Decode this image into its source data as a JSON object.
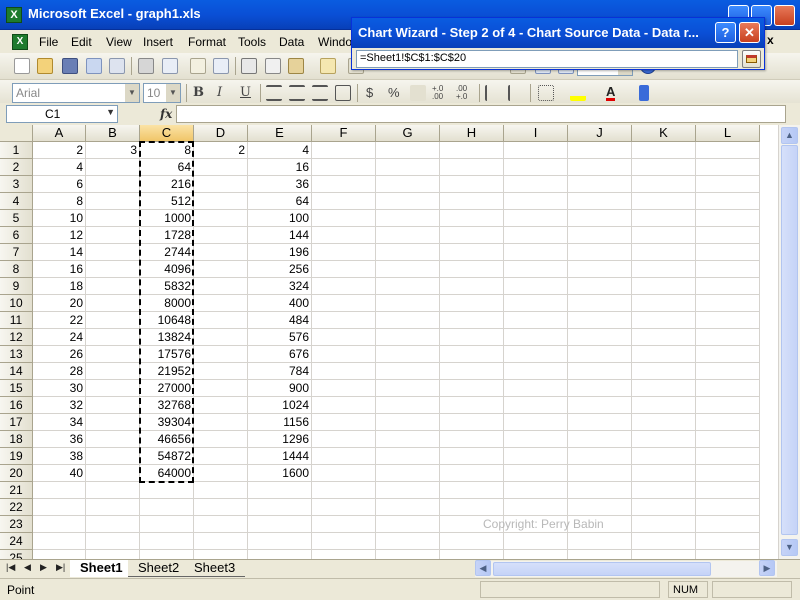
{
  "app": {
    "title": "Microsoft Excel - graph1.xls"
  },
  "window_controls": [
    "minimize",
    "maximize",
    "close"
  ],
  "menu": {
    "items": [
      "File",
      "Edit",
      "View",
      "Insert",
      "Format",
      "Tools",
      "Data",
      "Windo"
    ],
    "doc_close_glyph": "x"
  },
  "format_toolbar": {
    "font_name": "Arial",
    "font_size": "10",
    "bold": "B",
    "italic": "I",
    "underline": "U",
    "currency": "$",
    "percent": "%",
    "increase_decimal": "+.0 .00",
    "decrease_decimal": ".00 +.0",
    "font_color_glyph": "A"
  },
  "formula_bar": {
    "name_box": "C1",
    "fx": "fx",
    "content": ""
  },
  "columns": [
    "A",
    "B",
    "C",
    "D",
    "E",
    "F",
    "G",
    "H",
    "I",
    "J",
    "K",
    "L"
  ],
  "rows": [
    {
      "n": "1",
      "A": "2",
      "B": "3",
      "C": "8",
      "D": "2",
      "E": "4"
    },
    {
      "n": "2",
      "A": "4",
      "B": "",
      "C": "64",
      "D": "",
      "E": "16"
    },
    {
      "n": "3",
      "A": "6",
      "B": "",
      "C": "216",
      "D": "",
      "E": "36"
    },
    {
      "n": "4",
      "A": "8",
      "B": "",
      "C": "512",
      "D": "",
      "E": "64"
    },
    {
      "n": "5",
      "A": "10",
      "B": "",
      "C": "1000",
      "D": "",
      "E": "100"
    },
    {
      "n": "6",
      "A": "12",
      "B": "",
      "C": "1728",
      "D": "",
      "E": "144"
    },
    {
      "n": "7",
      "A": "14",
      "B": "",
      "C": "2744",
      "D": "",
      "E": "196"
    },
    {
      "n": "8",
      "A": "16",
      "B": "",
      "C": "4096",
      "D": "",
      "E": "256"
    },
    {
      "n": "9",
      "A": "18",
      "B": "",
      "C": "5832",
      "D": "",
      "E": "324"
    },
    {
      "n": "10",
      "A": "20",
      "B": "",
      "C": "8000",
      "D": "",
      "E": "400"
    },
    {
      "n": "11",
      "A": "22",
      "B": "",
      "C": "10648",
      "D": "",
      "E": "484"
    },
    {
      "n": "12",
      "A": "24",
      "B": "",
      "C": "13824",
      "D": "",
      "E": "576"
    },
    {
      "n": "13",
      "A": "26",
      "B": "",
      "C": "17576",
      "D": "",
      "E": "676"
    },
    {
      "n": "14",
      "A": "28",
      "B": "",
      "C": "21952",
      "D": "",
      "E": "784"
    },
    {
      "n": "15",
      "A": "30",
      "B": "",
      "C": "27000",
      "D": "",
      "E": "900"
    },
    {
      "n": "16",
      "A": "32",
      "B": "",
      "C": "32768",
      "D": "",
      "E": "1024"
    },
    {
      "n": "17",
      "A": "34",
      "B": "",
      "C": "39304",
      "D": "",
      "E": "1156"
    },
    {
      "n": "18",
      "A": "36",
      "B": "",
      "C": "46656",
      "D": "",
      "E": "1296"
    },
    {
      "n": "19",
      "A": "38",
      "B": "",
      "C": "54872",
      "D": "",
      "E": "1444"
    },
    {
      "n": "20",
      "A": "40",
      "B": "",
      "C": "64000",
      "D": "",
      "E": "1600"
    },
    {
      "n": "21"
    },
    {
      "n": "22"
    },
    {
      "n": "23"
    },
    {
      "n": "24"
    },
    {
      "n": "25"
    }
  ],
  "watermark": "Copyright: Perry Babin",
  "sheets": {
    "tabs": [
      "Sheet1",
      "Sheet2",
      "Sheet3"
    ],
    "active": "Sheet1",
    "nav": [
      "|◀",
      "◀",
      "▶",
      "▶|"
    ]
  },
  "status": {
    "text": "Point",
    "num": "NUM"
  },
  "dialog": {
    "title": "Chart Wizard - Step 2 of 4 - Chart Source Data - Data r...",
    "help": "?",
    "close": "✕",
    "range_value": "=Sheet1!$C$1:$C$20"
  },
  "colors": {
    "titlebar": "#0A4FD6",
    "selected_header": "#F0C568",
    "watermark": "#B8B8B8"
  }
}
